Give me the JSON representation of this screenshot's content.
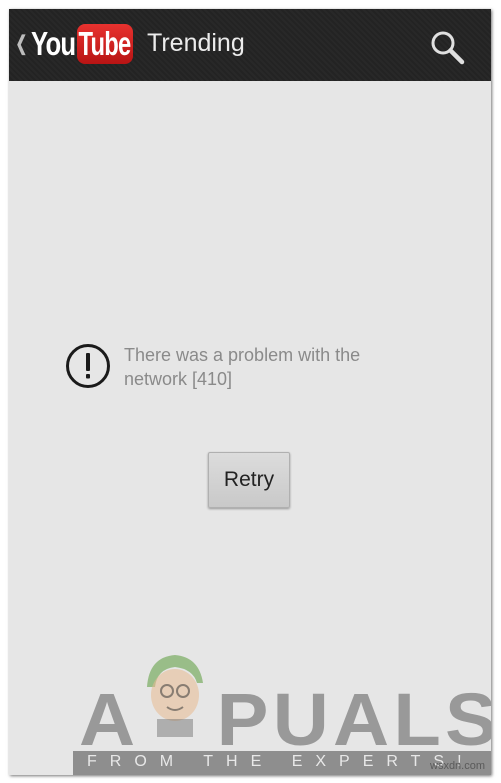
{
  "app_bar": {
    "logo_you": "You",
    "logo_tube": "Tube",
    "title": "Trending",
    "search_icon": "search-icon",
    "back_icon": "chevron-left-icon"
  },
  "error": {
    "icon": "error-icon",
    "message": "There was a problem with the network [410]"
  },
  "actions": {
    "retry_label": "Retry"
  },
  "watermark": {
    "text": "APPUALS",
    "tagline": "FROM THE EXPERTS!"
  },
  "credit": "wsxdn.com",
  "colors": {
    "app_bar_bg": "#232323",
    "content_bg": "#e6e6e6",
    "logo_red": "#d42323",
    "message_text": "#8a8a8a"
  }
}
